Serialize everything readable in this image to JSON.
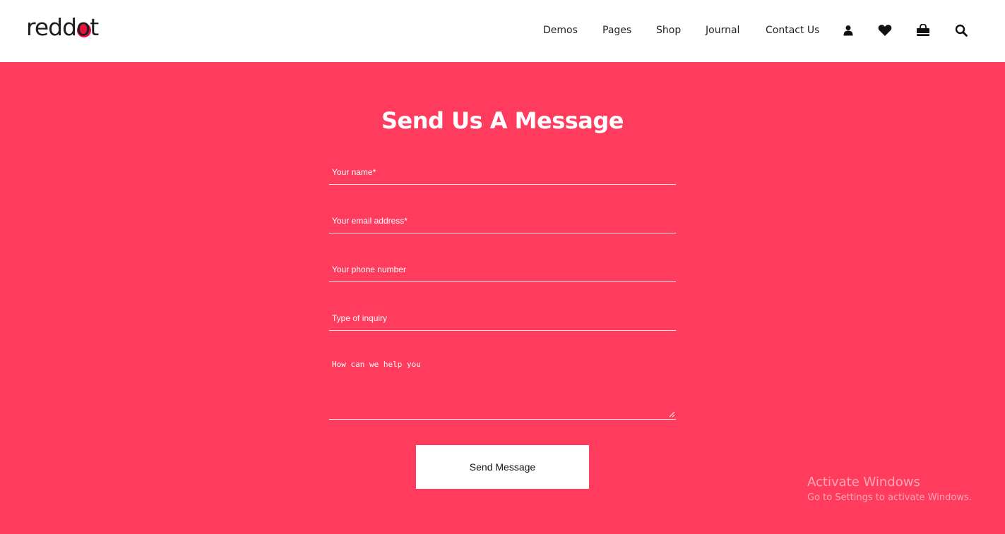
{
  "brand": {
    "logo_prefix": "redd",
    "logo_o": "o",
    "logo_suffix": "t"
  },
  "nav": {
    "items": [
      {
        "label": "Demos"
      },
      {
        "label": "Pages"
      },
      {
        "label": "Shop"
      },
      {
        "label": "Journal"
      },
      {
        "label": "Contact Us"
      }
    ],
    "icons": [
      "user-icon",
      "heart-icon",
      "shopping-bag-icon",
      "search-icon"
    ]
  },
  "form": {
    "title": "Send Us A Message",
    "name_placeholder": "Your name*",
    "email_placeholder": "Your email address*",
    "phone_placeholder": "Your phone number",
    "inquiry_placeholder": "Type of inquiry",
    "message_placeholder": "How can we help you",
    "submit_label": "Send Message"
  },
  "watermark": {
    "line1": "Activate Windows",
    "line2": "Go to Settings to activate Windows."
  },
  "colors": {
    "accent": "#ff3b5e",
    "logo_dot": "#e3133c",
    "header_bg": "#ffffff"
  }
}
